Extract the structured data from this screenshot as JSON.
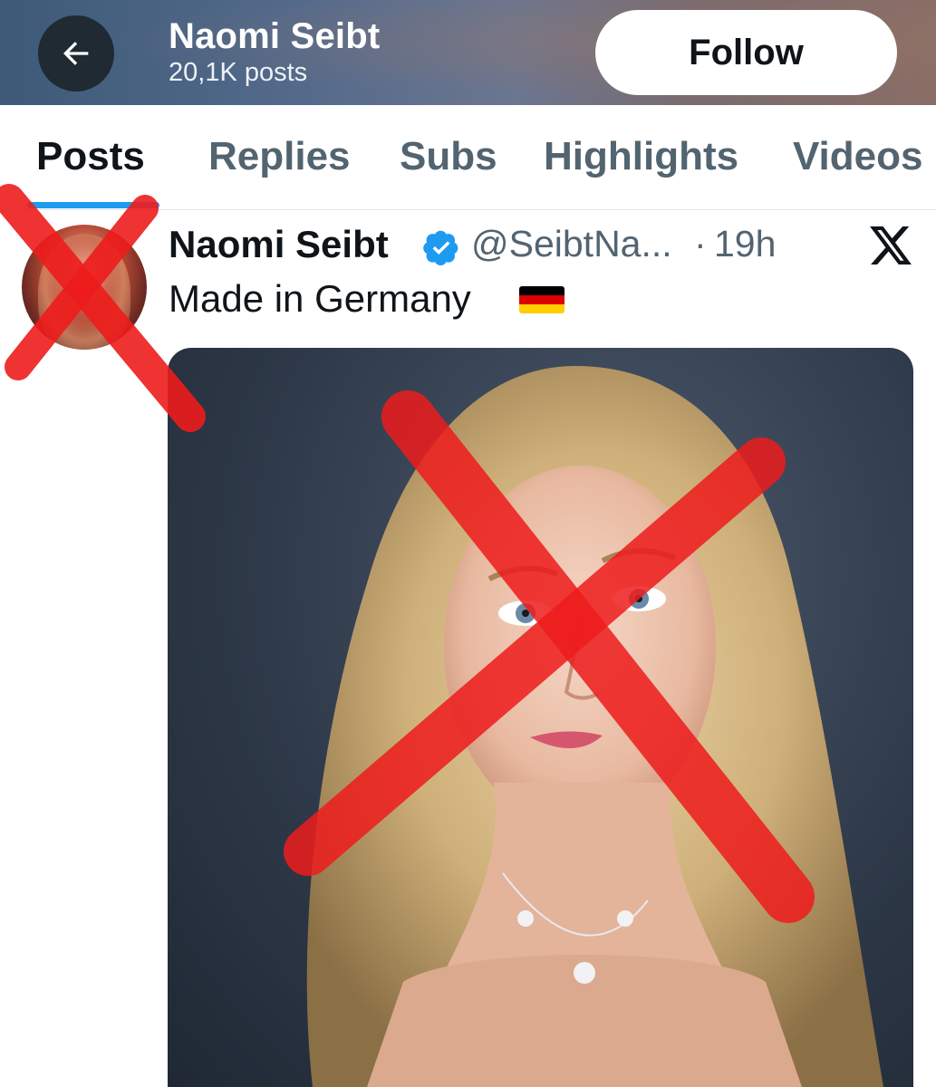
{
  "header": {
    "title": "Naomi Seibt",
    "post_count": "20,1K posts",
    "follow_label": "Follow"
  },
  "tabs": [
    {
      "label": "Posts",
      "active": true
    },
    {
      "label": "Replies",
      "active": false
    },
    {
      "label": "Subs",
      "active": false
    },
    {
      "label": "Highlights",
      "active": false
    },
    {
      "label": "Videos",
      "active": false
    }
  ],
  "post": {
    "author_name": "Naomi Seibt",
    "handle": "@SeibtNa...",
    "separator": "·",
    "time": "19h",
    "text": "Made in Germany",
    "flag": "germany-flag",
    "media": "portrait-photo"
  },
  "icons": {
    "back": "arrow-left-icon",
    "verified": "verified-badge-icon",
    "platform": "x-logo-icon"
  },
  "colors": {
    "accent": "#1d9bf0",
    "follow_bg": "#ffffff",
    "back_btn_bg": "#1f2a33",
    "muted_text": "#536471",
    "overlay_red": "#ee1c1c"
  }
}
